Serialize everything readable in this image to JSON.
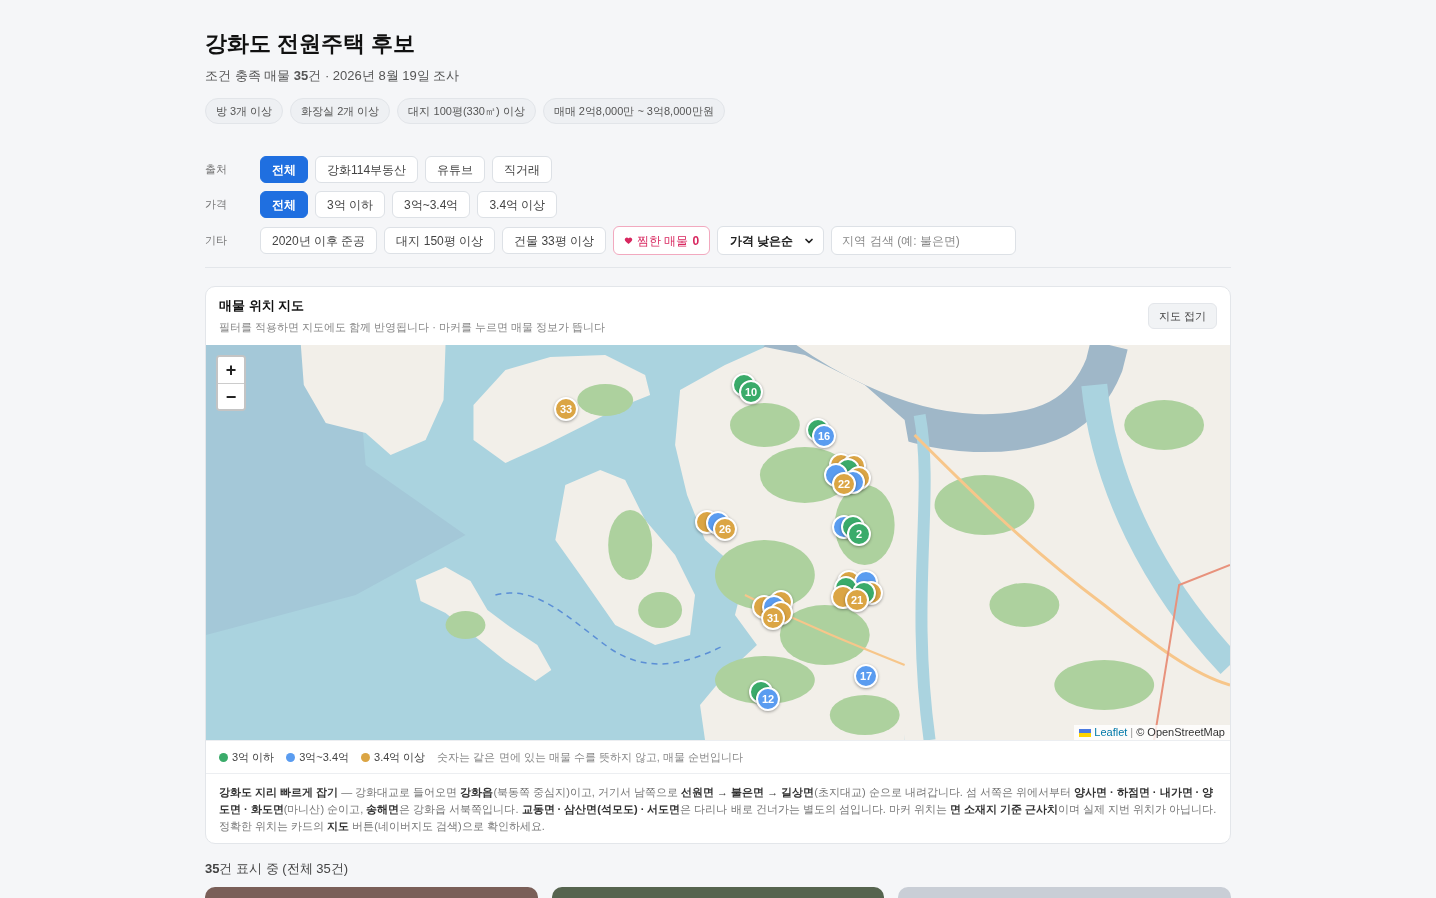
{
  "header": {
    "title": "강화도 전원주택 후보",
    "summary": "조건 충족 매물 **35**건 · 2026년 8월 19일 조사",
    "criteria": [
      "방 3개 이상",
      "화장실 2개 이상",
      "대지 100평(330㎡) 이상",
      "매매 2억8,000만 ~ 3억8,000만원"
    ]
  },
  "filters": [
    {
      "label": "출처",
      "options": [
        {
          "kind": "toggle",
          "label": "전체",
          "selected": true
        },
        {
          "kind": "toggle",
          "label": "강화114부동산",
          "selected": false
        },
        {
          "kind": "toggle",
          "label": "유튜브",
          "selected": false
        },
        {
          "kind": "toggle",
          "label": "직거래",
          "selected": false
        }
      ]
    },
    {
      "label": "가격",
      "options": [
        {
          "kind": "toggle",
          "label": "전체",
          "selected": true
        },
        {
          "kind": "toggle",
          "label": "3억 이하",
          "selected": false
        },
        {
          "kind": "toggle",
          "label": "3억~3.4억",
          "selected": false
        },
        {
          "kind": "toggle",
          "label": "3.4억 이상",
          "selected": false
        }
      ]
    },
    {
      "label": "기타",
      "options": [
        {
          "kind": "toggle",
          "label": "2020년 이후 준공",
          "selected": false
        },
        {
          "kind": "toggle",
          "label": "대지 150평 이상",
          "selected": false
        },
        {
          "kind": "toggle",
          "label": "건물 33평 이상",
          "selected": false
        },
        {
          "kind": "favorites",
          "label": "찜한 매물",
          "count": "0"
        },
        {
          "kind": "sort",
          "value": "가격 낮은순"
        },
        {
          "kind": "search",
          "placeholder": "지역 검색 (예: 불은면)"
        }
      ]
    }
  ],
  "map": {
    "title": "매물 위치 지도",
    "subtitle": "필터를 적용하면 지도에도 함께 반영됩니다 · 마커를 누르면 매물 정보가 뜹니다",
    "collapse_button": "지도 접기",
    "zoom_controls": [
      "+",
      "−"
    ],
    "markers": [
      {
        "label": "10",
        "color": "#3aab6a",
        "stack": [
          {
            "color": "#3aab6a"
          }
        ]
      },
      {
        "label": "33",
        "color": "#dba544"
      },
      {
        "label": "16",
        "color": "#5a9cf0",
        "stack": [
          {
            "color": "#3aab6a"
          }
        ]
      },
      {
        "label": "22",
        "color": "#dba544",
        "stack": [
          {
            "color": "#dba544"
          },
          {
            "color": "#dba544"
          },
          {
            "color": "#3aab6a"
          },
          {
            "color": "#dba544"
          },
          {
            "color": "#5a9cf0"
          },
          {
            "color": "#5a9cf0"
          }
        ]
      },
      {
        "label": "26",
        "color": "#dba544",
        "stack": [
          {
            "color": "#dba544"
          },
          {
            "color": "#5a9cf0"
          }
        ]
      },
      {
        "label": "2",
        "color": "#3aab6a",
        "stack": [
          {
            "color": "#5a9cf0"
          },
          {
            "color": "#3aab6a"
          }
        ]
      },
      {
        "label": "21",
        "color": "#dba544",
        "stack": [
          {
            "color": "#dba544"
          },
          {
            "color": "#5a9cf0"
          },
          {
            "color": "#3aab6a"
          },
          {
            "color": "#dba544"
          },
          {
            "color": "#3aab6a"
          },
          {
            "color": "#dba544"
          }
        ]
      },
      {
        "label": "31",
        "color": "#dba544",
        "stack": [
          {
            "color": "#dba544"
          },
          {
            "color": "#dba544"
          },
          {
            "color": "#5a9cf0"
          },
          {
            "color": "#dba544"
          }
        ]
      },
      {
        "label": "17",
        "color": "#5a9cf0"
      },
      {
        "label": "12",
        "color": "#5a9cf0",
        "stack": [
          {
            "color": "#3aab6a"
          }
        ]
      }
    ],
    "attribution": {
      "link": "Leaflet",
      "separator": "|",
      "text": "© OpenStreetMap"
    },
    "legend": [
      {
        "label": "3억 이하",
        "color": "#3aab6a"
      },
      {
        "label": "3억~3.4억",
        "color": "#5a9cf0"
      },
      {
        "label": "3.4억 이상",
        "color": "#dba544"
      }
    ],
    "legend_note": "숫자는 같은 면에 있는 매물 수를 뜻하지 않고, 매물 순번입니다",
    "guide": "**강화도 지리 빠르게 잡기** — 강화대교로 들어오면 **강화읍**(북동쪽 중심지)이고, 거기서 남쪽으로 **선원면 → 불은면 → 길상면**(초지대교) 순으로 내려갑니다. 섬 서쪽은 위에서부터 **양사면 · 하점면 · 내가면 · 양도면 · 화도면**(마니산) 순이고, **송해면**은 강화읍 서북쪽입니다. **교동면 · 삼산면(석모도) · 서도면**은 다리나 배로 건너가는 별도의 섬입니다. 마커 위치는 **면 소재지 기준 근사치**이며 실제 지번 위치가 아닙니다. 정확한 위치는 카드의 **지도** 버튼(네이버지도 검색)으로 확인하세요."
  },
  "results": {
    "summary": "**35**건 표시 중 (전체 35건)",
    "cards": [
      {
        "kind": "photo"
      },
      {
        "kind": "photo"
      },
      {
        "kind": "photo"
      }
    ]
  }
}
